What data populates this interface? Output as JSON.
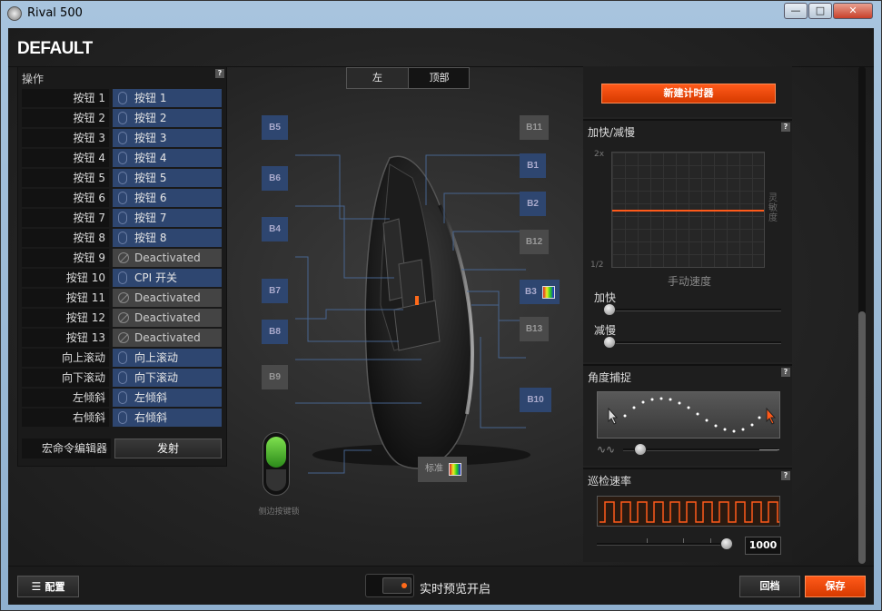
{
  "window": {
    "title": "Rival 500",
    "minimize": "—",
    "maximize": "□",
    "close": "✕"
  },
  "profile": {
    "name": "DEFAULT"
  },
  "left_panel": {
    "heading": "操作",
    "help": "?",
    "rows": [
      {
        "label": "按钮 1",
        "value": "按钮 1",
        "type": "mouse"
      },
      {
        "label": "按钮 2",
        "value": "按钮 2",
        "type": "mouse"
      },
      {
        "label": "按钮 3",
        "value": "按钮 3",
        "type": "mouse"
      },
      {
        "label": "按钮 4",
        "value": "按钮 4",
        "type": "mouse"
      },
      {
        "label": "按钮 5",
        "value": "按钮 5",
        "type": "mouse"
      },
      {
        "label": "按钮 6",
        "value": "按钮 6",
        "type": "mouse"
      },
      {
        "label": "按钮 7",
        "value": "按钮 7",
        "type": "mouse"
      },
      {
        "label": "按钮 8",
        "value": "按钮 8",
        "type": "mouse"
      },
      {
        "label": "按钮 9",
        "value": "Deactivated",
        "type": "off"
      },
      {
        "label": "按钮 10",
        "value": "CPI 开关",
        "type": "cpi"
      },
      {
        "label": "按钮 11",
        "value": "Deactivated",
        "type": "off"
      },
      {
        "label": "按钮 12",
        "value": "Deactivated",
        "type": "off"
      },
      {
        "label": "按钮 13",
        "value": "Deactivated",
        "type": "off"
      },
      {
        "label": "向上滚动",
        "value": "向上滚动",
        "type": "mouse"
      },
      {
        "label": "向下滚动",
        "value": "向下滚动",
        "type": "mouse"
      },
      {
        "label": "左倾斜",
        "value": "左倾斜",
        "type": "mouse"
      },
      {
        "label": "右倾斜",
        "value": "右倾斜",
        "type": "mouse"
      }
    ],
    "macro": {
      "label": "宏命令编辑器",
      "button": "发射"
    }
  },
  "view_tabs": {
    "left": "左",
    "top": "顶部"
  },
  "buttons": {
    "b5": "B5",
    "b6": "B6",
    "b4": "B4",
    "b7": "B7",
    "b8": "B8",
    "b9": "B9",
    "b11": "B11",
    "b1": "B1",
    "b2": "B2",
    "b12": "B12",
    "b3": "B3",
    "b13": "B13",
    "b10": "B10"
  },
  "lock_label": "侧边按键锁",
  "standard_label": "标准",
  "right_panel": {
    "timer_button": "新建计时器",
    "accel": {
      "title": "加快/减慢",
      "help": "?",
      "y_top": "2x",
      "y_bottom": "1/2",
      "x_label": "手动速度",
      "side_label": "灵敏度",
      "accel_label": "加快",
      "decel_label": "减慢",
      "accel_level": 0,
      "decel_level": 0
    },
    "angle": {
      "title": "角度捕捉",
      "help": "?",
      "level": 0.08
    },
    "polling": {
      "title": "巡检速率",
      "help": "?",
      "value": "1000",
      "level": 1
    }
  },
  "bottom": {
    "config": "配置",
    "preview": "实时预览开启",
    "revert": "回档",
    "save": "保存"
  },
  "colors": {
    "accent": "#ff5a1a",
    "assigned": "#2e4670",
    "deactivated": "#444444",
    "lock_green": "#4fc02a"
  }
}
